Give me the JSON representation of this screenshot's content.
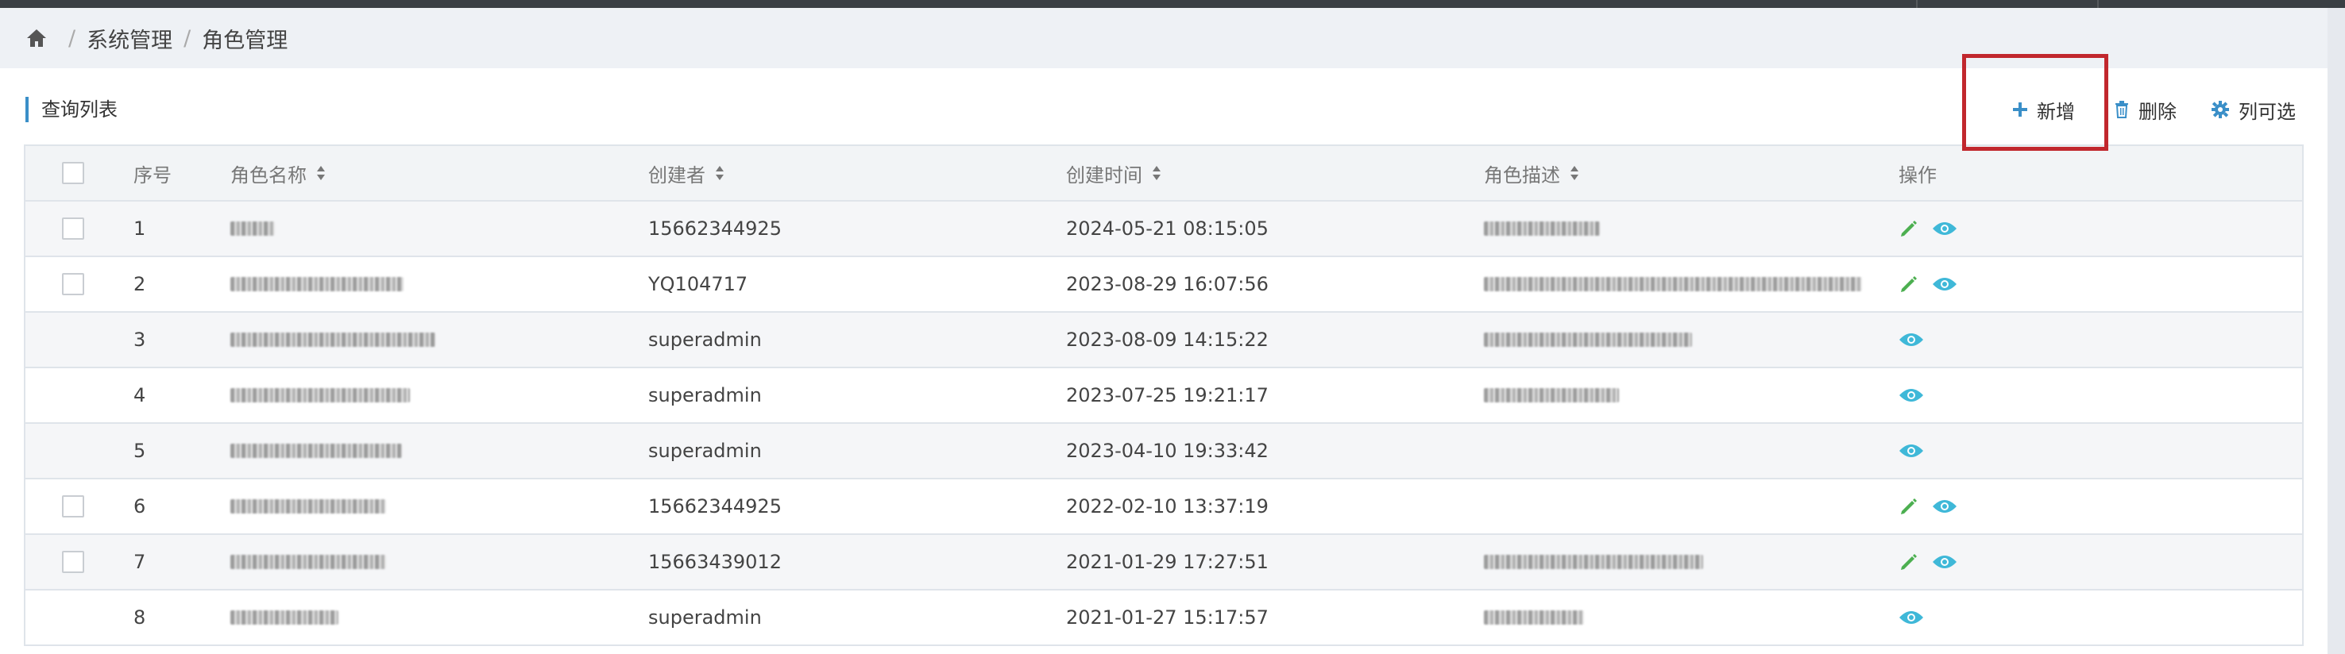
{
  "breadcrumb": {
    "items": [
      "系统管理",
      "角色管理"
    ]
  },
  "panel": {
    "title": "查询列表"
  },
  "toolbar": {
    "add_label": "新增",
    "delete_label": "删除",
    "columns_label": "列可选"
  },
  "table": {
    "headers": {
      "seq": "序号",
      "name": "角色名称",
      "creator": "创建者",
      "time": "创建时间",
      "desc": "角色描述",
      "ops": "操作"
    },
    "rows": [
      {
        "seq": "1",
        "creator": "15662344925",
        "time": "2024-05-21 08:15:05",
        "editable": true
      },
      {
        "seq": "2",
        "creator": "YQ104717",
        "time": "2023-08-29 16:07:56",
        "editable": true
      },
      {
        "seq": "3",
        "creator": "superadmin",
        "time": "2023-08-09 14:15:22",
        "editable": false
      },
      {
        "seq": "4",
        "creator": "superadmin",
        "time": "2023-07-25 19:21:17",
        "editable": false
      },
      {
        "seq": "5",
        "creator": "superadmin",
        "time": "2023-04-10 19:33:42",
        "editable": false
      },
      {
        "seq": "6",
        "creator": "15662344925",
        "time": "2022-02-10 13:37:19",
        "editable": true
      },
      {
        "seq": "7",
        "creator": "15663439012",
        "time": "2021-01-29 17:27:51",
        "editable": true
      },
      {
        "seq": "8",
        "creator": "superadmin",
        "time": "2021-01-27 15:17:57",
        "editable": false
      }
    ]
  },
  "colors": {
    "accent": "#3a8fc8",
    "edit_icon": "#4caf50",
    "view_icon": "#3fb8d8",
    "highlight": "#c1272d"
  },
  "icons": {
    "home": "home-icon",
    "add": "plus-icon",
    "delete": "trash-icon",
    "columns": "gear-icon",
    "edit": "pencil-icon",
    "view": "eye-icon"
  }
}
